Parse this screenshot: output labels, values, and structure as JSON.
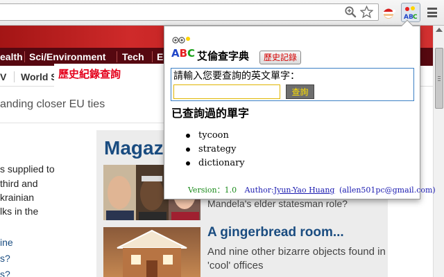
{
  "browser": {
    "menu_icon": "hamburger-menu-icon"
  },
  "page": {
    "nav_items": [
      "ealth",
      "Sci/Environment",
      "Tech",
      "E"
    ],
    "subnav_items": [
      "V",
      "World S"
    ],
    "history_overlay": "歷史紀錄查詢",
    "headline_snippet": "anding closer EU ties",
    "left_column": [
      "s supplied to",
      " third and",
      "krainian",
      "lks in the",
      "ine",
      "s?",
      "s?"
    ],
    "magazine": {
      "title": "Magaz",
      "story1_snippet": "Mandela's elder statesman role?",
      "story2_title": "A gingerbread room...",
      "story2_subtitle": "And nine other bizarre objects found in 'cool' offices"
    }
  },
  "popup": {
    "logo_text": "ABC",
    "app_title": "艾倫查字典",
    "history_button": "歷史記錄",
    "query_prompt": "請輸入您要查詢的英文單字：",
    "input_value": "",
    "query_button": "查詢",
    "queried_heading": "已查詢過的單字",
    "queried_words": [
      "tycoon",
      "strategy",
      "dictionary"
    ],
    "version_label": "Version：1.0",
    "author_label": "Author:",
    "author_name": "Jyun-Yao Huang",
    "author_email": "(allen501pc@gmail.com)"
  },
  "colors": {
    "nav_dark": "#560810",
    "banner_red": "#c0262a",
    "magazine_blue": "#1a4c80",
    "history_red": "#e4001b",
    "version_green": "#1a8a1a",
    "author_blue": "#1a1ab0",
    "query_button_text": "#ffe000"
  }
}
